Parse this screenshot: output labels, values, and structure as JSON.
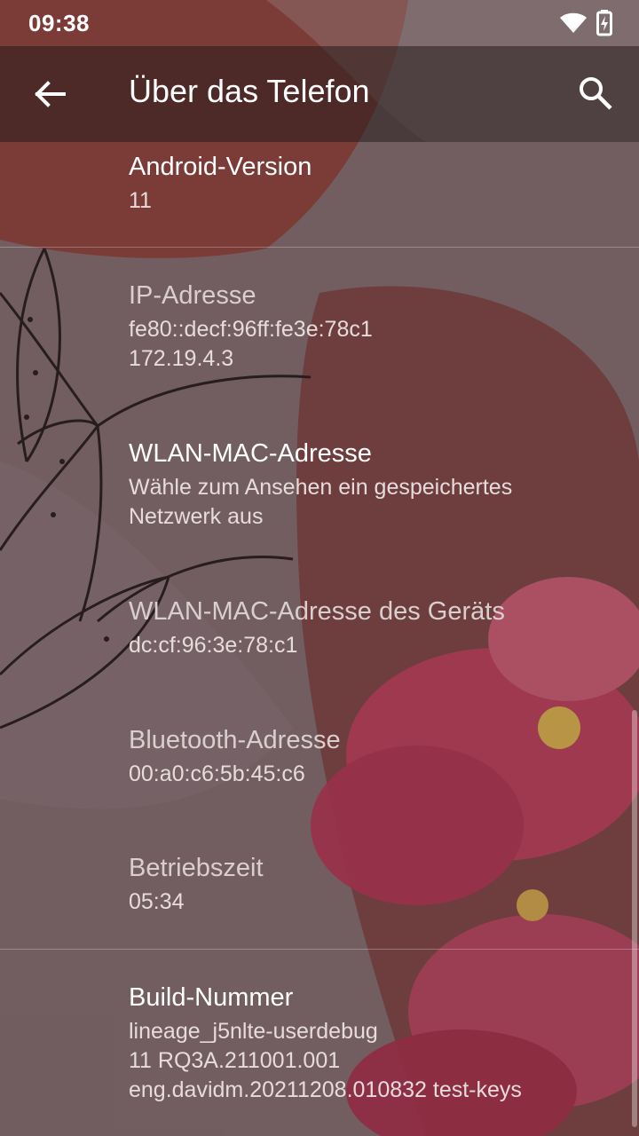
{
  "status_bar": {
    "time": "09:38",
    "icons": [
      "wifi-icon",
      "battery-charging-icon"
    ]
  },
  "app_bar": {
    "title": "Über das Telefon",
    "back_icon": "arrow-back-icon",
    "search_icon": "search-icon"
  },
  "items": [
    {
      "label": "Android-Version",
      "lines": [
        "11"
      ]
    },
    {
      "label": "IP-Adresse",
      "lines": [
        "fe80::decf:96ff:fe3e:78c1",
        "172.19.4.3"
      ]
    },
    {
      "label": "WLAN-MAC-Adresse",
      "lines": [
        "Wähle zum Ansehen ein gespeichertes",
        "Netzwerk aus"
      ]
    },
    {
      "label": "WLAN-MAC-Adresse des Geräts",
      "lines": [
        "dc:cf:96:3e:78:c1"
      ]
    },
    {
      "label": "Bluetooth-Adresse",
      "lines": [
        "00:a0:c6:5b:45:c6"
      ]
    },
    {
      "label": "Betriebszeit",
      "lines": [
        "05:34"
      ]
    },
    {
      "label": "Build-Nummer",
      "lines": [
        "lineage_j5nlte-userdebug",
        "11 RQ3A.211001.001",
        "eng.davidm.20211208.010832 test-keys"
      ]
    }
  ],
  "colors": {
    "accent_flower": "#c23a5a",
    "blob_dark": "#8a3b35",
    "background": "#7a5655"
  }
}
